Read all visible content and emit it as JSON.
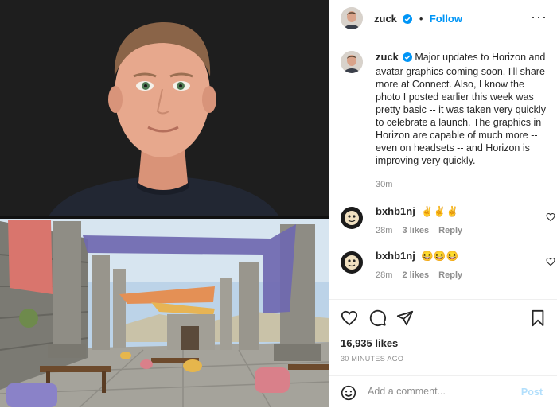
{
  "post": {
    "author": "zuck",
    "follow_label": "Follow",
    "dot": "•",
    "more_label": "···"
  },
  "caption": {
    "username": "zuck",
    "text": "Major updates to Horizon and avatar graphics coming soon. I'll share more at Connect. Also, I know the photo I posted earlier this week was pretty basic -- it was taken very quickly to celebrate a launch. The graphics in Horizon are capable of much more -- even on headsets -- and Horizon is improving very quickly.",
    "time": "30m"
  },
  "comments": [
    {
      "username": "bxhb1nj",
      "text": "✌️✌️✌️",
      "time": "28m",
      "likes": "3 likes",
      "reply": "Reply"
    },
    {
      "username": "bxhb1nj",
      "text": "😆😆😆",
      "time": "28m",
      "likes": "2 likes",
      "reply": "Reply"
    }
  ],
  "stats": {
    "likes": "16,935 likes",
    "date": "30 MINUTES AGO"
  },
  "composer": {
    "placeholder": "Add a comment...",
    "post_label": "Post"
  },
  "icons": {
    "verified": "verified-badge-icon",
    "heart": "heart-icon",
    "comment": "comment-bubble-icon",
    "share": "paper-plane-icon",
    "save": "bookmark-icon",
    "emoji": "smiley-emoji-icon"
  },
  "colors": {
    "accent": "#0095f6",
    "post_disabled": "#b2dffc",
    "muted": "#8e8e8e",
    "text": "#262626"
  }
}
